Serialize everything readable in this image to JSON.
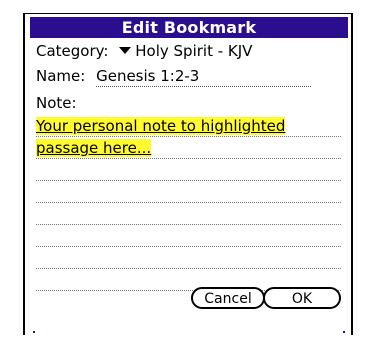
{
  "dialog": {
    "title": "Edit Bookmark",
    "category_label": "Category:",
    "category_value": "Holy Spirit - KJV",
    "name_label": "Name:",
    "name_value": "Genesis 1:2-3",
    "note_label": "Note:",
    "note_lines": [
      "Your personal note to highlighted",
      "passage here..."
    ],
    "cancel_label": "Cancel",
    "ok_label": "OK",
    "colors": {
      "title_bar": "#2b0d8f",
      "highlight": "#fffb2e"
    },
    "icons": {
      "category_trigger": "triangle-down-icon"
    }
  }
}
